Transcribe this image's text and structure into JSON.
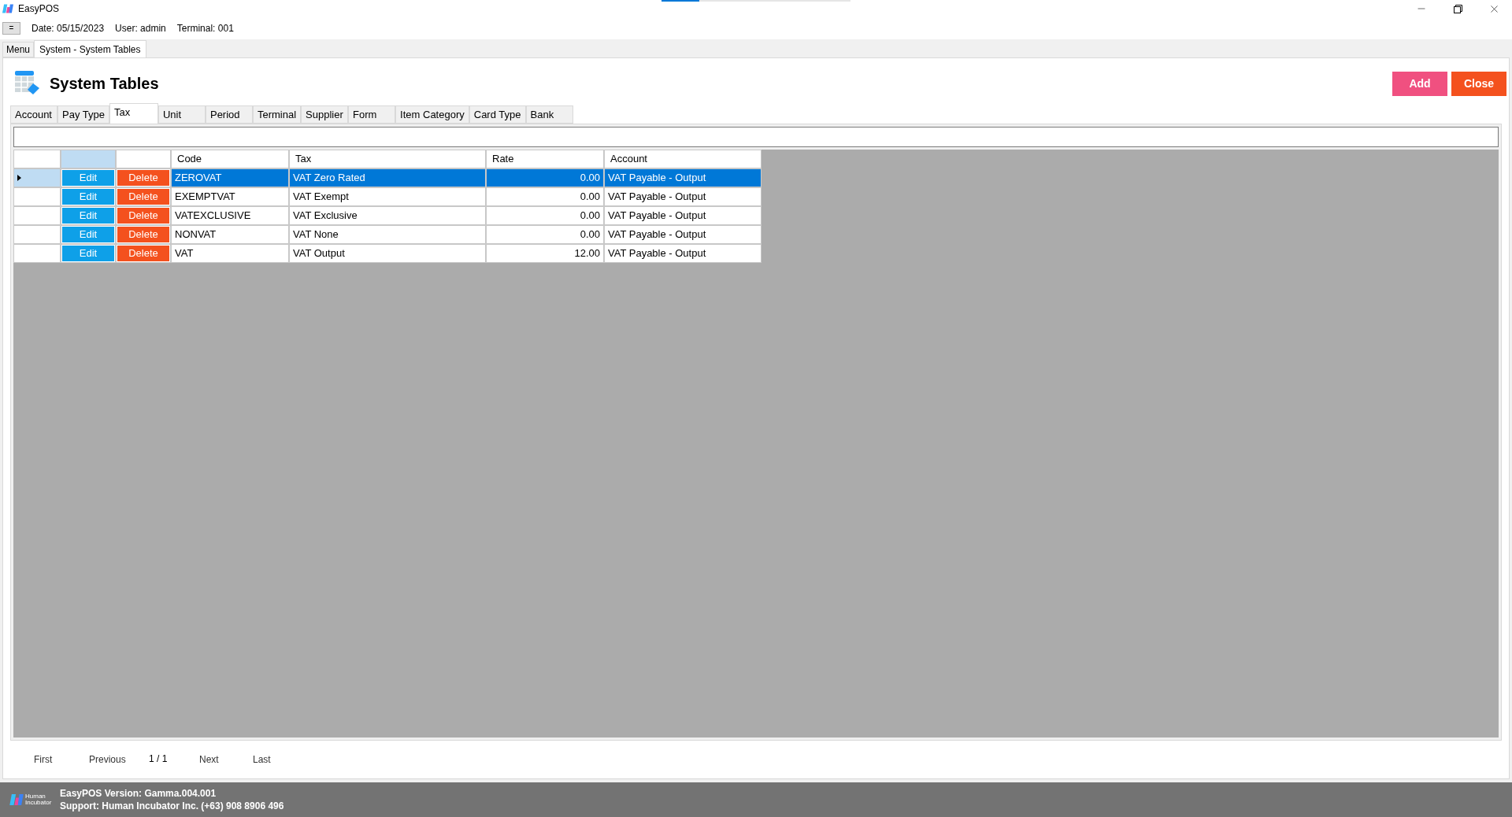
{
  "window": {
    "title": "EasyPOS",
    "progress": {
      "level": 0.2
    }
  },
  "info_bar": {
    "menu_button": "=",
    "date": "Date: 05/15/2023",
    "user": "User: admin",
    "terminal": "Terminal: 001"
  },
  "doc_tabs": [
    {
      "label": "Menu",
      "selected": false
    },
    {
      "label": "System - System Tables",
      "selected": true
    }
  ],
  "page": {
    "title": "System Tables",
    "buttons": [
      {
        "label": "Add",
        "kind": "add"
      },
      {
        "label": "Close",
        "kind": "close"
      }
    ]
  },
  "tabs": [
    {
      "label": "Account",
      "selected": false
    },
    {
      "label": "Pay Type",
      "selected": false
    },
    {
      "label": "Tax",
      "selected": true
    },
    {
      "label": "Unit",
      "selected": false
    },
    {
      "label": "Period",
      "selected": false
    },
    {
      "label": "Terminal",
      "selected": false
    },
    {
      "label": "Supplier",
      "selected": false
    },
    {
      "label": "Form",
      "selected": false
    },
    {
      "label": "Item Category",
      "selected": false
    },
    {
      "label": "Card Type",
      "selected": false
    },
    {
      "label": "Bank",
      "selected": false
    }
  ],
  "table": {
    "columns": [
      "Code",
      "Tax",
      "Rate",
      "Account"
    ],
    "rows": [
      {
        "edit": "Edit",
        "delete": "Delete",
        "code": "ZEROVAT",
        "tax": "VAT Zero Rated",
        "rate": "0.00",
        "account": "VAT Payable - Output",
        "selected": true
      },
      {
        "edit": "Edit",
        "delete": "Delete",
        "code": "EXEMPTVAT",
        "tax": "VAT Exempt",
        "rate": "0.00",
        "account": "VAT Payable - Output",
        "selected": false
      },
      {
        "edit": "Edit",
        "delete": "Delete",
        "code": "VATEXCLUSIVE",
        "tax": "VAT Exclusive",
        "rate": "0.00",
        "account": "VAT Payable - Output",
        "selected": false
      },
      {
        "edit": "Edit",
        "delete": "Delete",
        "code": "NONVAT",
        "tax": "VAT None",
        "rate": "0.00",
        "account": "VAT Payable - Output",
        "selected": false
      },
      {
        "edit": "Edit",
        "delete": "Delete",
        "code": "VAT",
        "tax": "VAT Output",
        "rate": "12.00",
        "account": "VAT Payable - Output",
        "selected": false
      }
    ]
  },
  "pager": {
    "first": "First",
    "previous": "Previous",
    "page": "1 / 1",
    "next": "Next",
    "last": "Last"
  },
  "status_bar": {
    "logo_text": "Human Incubator",
    "version": "EasyPOS Version: Gamma.004.001",
    "support": "Support: Human Incubator Inc. (+63) 908 8906 496"
  }
}
